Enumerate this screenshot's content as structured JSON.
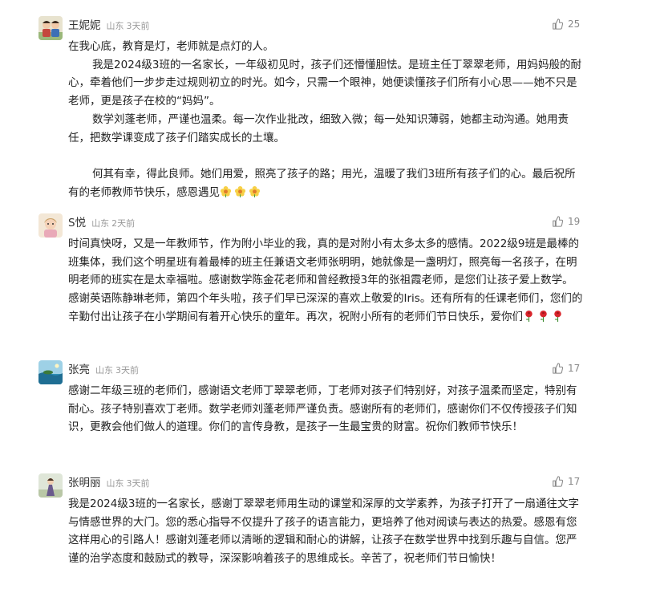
{
  "comments": [
    {
      "name": "王妮妮",
      "location": "山东",
      "time": "3天前",
      "likes": "25",
      "paragraphs": [
        "在我心底，教育是灯，老师就是点灯的人。",
        "       我是2024级3班的一名家长，一年级初见时，孩子们还懵懂胆怯。是班主任丁翠翠老师，用妈妈般的耐心，牵着他们一步步走过规则初立的时光。如今，只需一个眼神，她便读懂孩子们所有小心思——她不只是老师，更是孩子在校的“妈妈”。",
        "       数学刘蓬老师，严谨也温柔。每一次作业批改，细致入微；每一处知识薄弱，她都主动沟通。她用责任，把数学课变成了孩子们踏实成长的土壤。",
        "",
        "       何其有幸，得此良师。她们用爱，照亮了孩子的路；用光，温暖了我们3班所有孩子们的心。最后祝所有的老师教师节快乐，感恩遇见"
      ],
      "emoji": [
        "flower-emoji",
        "flower-emoji",
        "flower-emoji"
      ]
    },
    {
      "name": "S悦",
      "location": "山东",
      "time": "2天前",
      "likes": "19",
      "paragraphs": [
        "时间真快呀，又是一年教师节，作为附小毕业的我，真的是对附小有太多太多的感情。2022级9班是最棒的班集体，我们这个明星班有着最棒的班主任兼语文老师张明明，她就像是一盏明灯，照亮每一名孩子，在明明老师的班实在是太幸福啦。感谢数学陈金花老师和曾经教授3年的张祖霞老师，是您们让孩子爱上数学。感谢英语陈静琳老师，第四个年头啦，孩子们早已深深的喜欢上敬爱的Iris。还有所有的任课老师们，您们的辛勤付出让孩子在小学期间有着开心快乐的童年。再次，祝附小所有的老师们节日快乐，爱你们"
      ],
      "emoji": [
        "rose-emoji",
        "rose-emoji",
        "rose-emoji"
      ]
    },
    {
      "name": "张亮",
      "location": "山东",
      "time": "3天前",
      "likes": "17",
      "paragraphs": [
        "感谢二年级三班的老师们，感谢语文老师丁翠翠老师，丁老师对孩子们特别好，对孩子温柔而坚定，特别有耐心。孩子特别喜欢丁老师。数学老师刘蓬老师严谨负责。感谢所有的老师们，感谢你们不仅传授孩子们知识，更教会他们做人的道理。你们的言传身教，是孩子一生最宝贵的财富。祝你们教师节快乐！"
      ],
      "emoji": []
    },
    {
      "name": "张明丽",
      "location": "山东",
      "time": "3天前",
      "likes": "17",
      "paragraphs": [
        "我是2024级3班的一名家长，感谢丁翠翠老师用生动的课堂和深厚的文学素养，为孩子打开了一扇通往文字与情感世界的大门。您的悉心指导不仅提升了孩子的语言能力，更培养了他对阅读与表达的热爱。感恩有您这样用心的引路人！感谢刘蓬老师以清晰的逻辑和耐心的讲解，让孩子在数学世界中找到乐趣与自信。您严谨的治学态度和鼓励式的教导，深深影响着孩子的思维成长。辛苦了，祝老师们节日愉快！"
      ],
      "emoji": []
    }
  ],
  "icons": {
    "like": "thumbs-up-icon",
    "flower": "flower-emoji",
    "rose": "rose-emoji"
  },
  "colors": {
    "name": "#333333",
    "meta": "#999999",
    "body": "#222222",
    "like_count": "#888888"
  }
}
